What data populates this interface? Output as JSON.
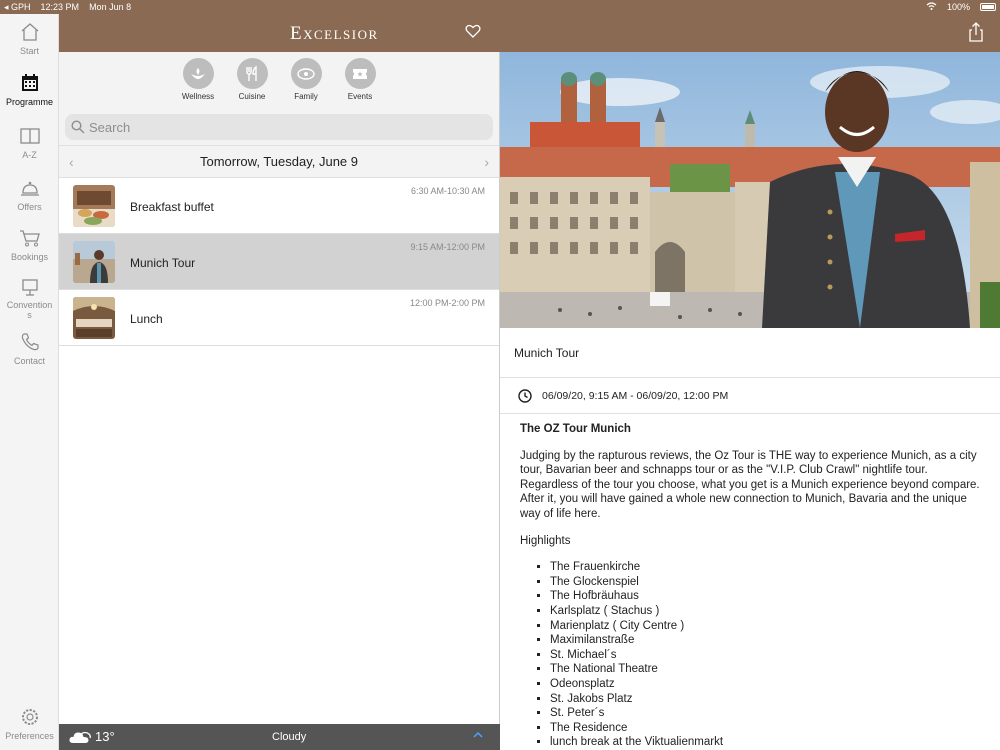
{
  "status": {
    "carrier": "◂ GPH",
    "time": "12:23 PM",
    "date": "Mon Jun 8",
    "battery": "100%"
  },
  "sidebar": [
    {
      "label": "Start",
      "icon": "home-icon"
    },
    {
      "label": "Programme",
      "icon": "calendar-icon"
    },
    {
      "label": "A-Z",
      "icon": "book-icon"
    },
    {
      "label": "Offers",
      "icon": "bell-icon"
    },
    {
      "label": "Bookings",
      "icon": "cart-icon"
    },
    {
      "label": "Convention",
      "label2": "s",
      "icon": "easel-icon"
    },
    {
      "label": "Contact",
      "icon": "phone-icon"
    },
    {
      "label": "Preferences",
      "icon": "gear-icon"
    }
  ],
  "header": {
    "brand": "Excelsior"
  },
  "categories": [
    "Wellness",
    "Cuisine",
    "Family",
    "Events"
  ],
  "search": {
    "placeholder": "Search"
  },
  "datebar": {
    "label": "Tomorrow, Tuesday, June 9"
  },
  "events": [
    {
      "name": "Breakfast buffet",
      "time": "6:30 AM-10:30 AM"
    },
    {
      "name": "Munich Tour",
      "time": "9:15 AM-12:00 PM"
    },
    {
      "name": "Lunch",
      "time": "12:00 PM-2:00 PM"
    }
  ],
  "weather": {
    "temp": "13°",
    "condition": "Cloudy"
  },
  "detail": {
    "title": "Munich Tour",
    "datetime": "06/09/20, 9:15 AM - 06/09/20, 12:00 PM",
    "heading": "The OZ Tour Munich",
    "paragraph": "Judging by the rapturous reviews, the Oz Tour is THE way to experience Munich, as a city tour, Bavarian beer and schnapps tour or as the \"V.I.P. Club Crawl\" nightlife tour. Regardless of the tour you choose, what you get is a Munich experience beyond compare. After it, you will have gained a whole new connection to Munich, Bavaria and the unique way of life here.",
    "highlights_label": "Highlights",
    "highlights": [
      "The Frauenkirche",
      "The Glockenspiel",
      "The Hofbräuhaus",
      "Karlsplatz ( Stachus )",
      "Marienplatz ( City Centre )",
      "Maximilanstraße",
      "St. Michael´s",
      "The National Theatre",
      "Odeonsplatz",
      "St. Jakobs Platz",
      "St. Peter´s",
      "The Residence",
      "lunch break at the Viktualienmarkt"
    ]
  },
  "colors": {
    "brand": "#8a6a52",
    "weather_bar": "#555555",
    "selected_row": "#d2d2d2"
  }
}
